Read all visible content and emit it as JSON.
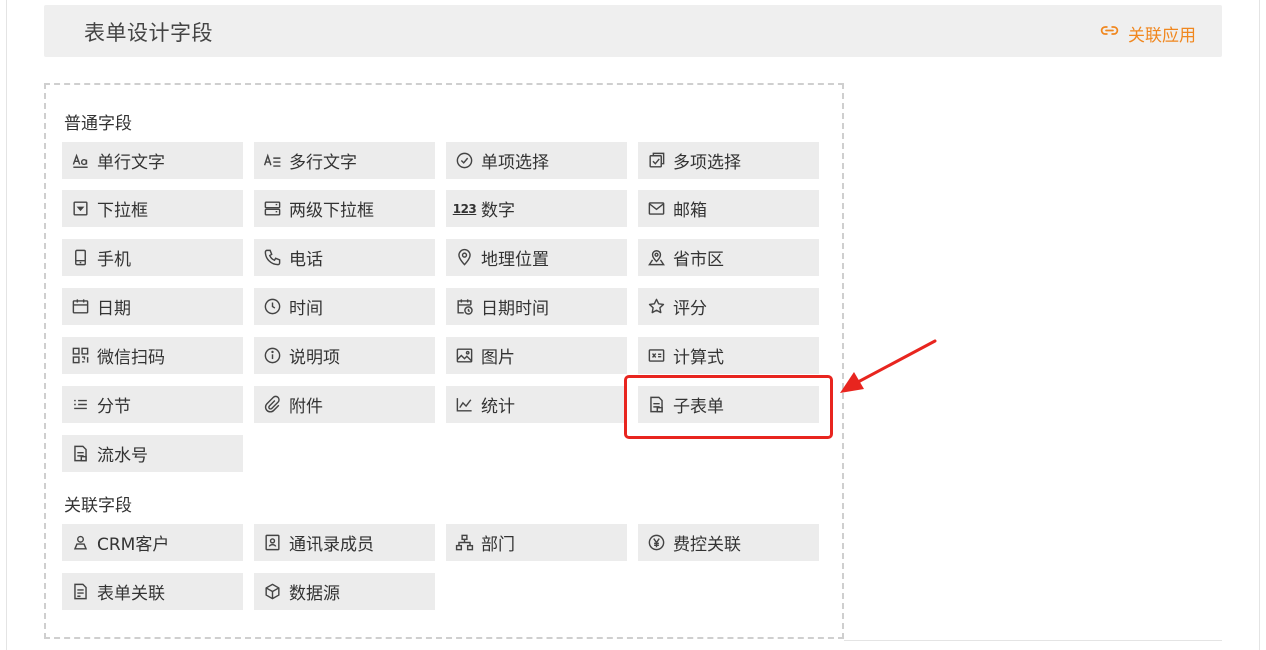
{
  "header": {
    "title": "表单设计字段",
    "link_label": "关联应用"
  },
  "sections": {
    "common": "普通字段",
    "related": "关联字段"
  },
  "fields": {
    "single_line_text": "单行文字",
    "multi_line_text": "多行文字",
    "single_choice": "单项选择",
    "multi_choice": "多项选择",
    "dropdown": "下拉框",
    "two_level_dropdown": "两级下拉框",
    "number": "数字",
    "email": "邮箱",
    "mobile": "手机",
    "phone": "电话",
    "location": "地理位置",
    "region": "省市区",
    "date": "日期",
    "time": "时间",
    "datetime": "日期时间",
    "rating": "评分",
    "wechat_scan": "微信扫码",
    "description": "说明项",
    "image": "图片",
    "formula": "计算式",
    "section": "分节",
    "attachment": "附件",
    "statistics": "统计",
    "subform": "子表单",
    "serial_number": "流水号",
    "crm_customer": "CRM客户",
    "contact_member": "通讯录成员",
    "department": "部门",
    "expense_link": "费控关联",
    "form_link": "表单关联",
    "data_source": "数据源"
  },
  "icon_text": {
    "number": "123"
  },
  "colors": {
    "accent": "#f0871f",
    "highlight": "#e8251f",
    "field_bg": "#ececec"
  },
  "icons": {
    "single_line_text": "text-aa-icon",
    "multi_line_text": "text-lines-icon",
    "single_choice": "circle-check-icon",
    "multi_choice": "square-check-icon",
    "dropdown": "dropdown-icon",
    "two_level_dropdown": "stacked-dropdown-icon",
    "number": "number-123-icon",
    "email": "mail-icon",
    "mobile": "mobile-icon",
    "phone": "phone-icon",
    "location": "location-pin-icon",
    "region": "map-pin-icon",
    "date": "calendar-icon",
    "time": "clock-icon",
    "datetime": "calendar-clock-icon",
    "rating": "star-icon",
    "wechat_scan": "qrcode-icon",
    "description": "info-icon",
    "image": "image-icon",
    "formula": "formula-icon",
    "section": "list-icon",
    "attachment": "paperclip-icon",
    "statistics": "chart-line-icon",
    "subform": "document-icon",
    "serial_number": "document-icon",
    "crm_customer": "user-icon",
    "contact_member": "contact-card-icon",
    "department": "org-chart-icon",
    "expense_link": "yen-icon",
    "form_link": "form-icon",
    "data_source": "cube-icon"
  }
}
